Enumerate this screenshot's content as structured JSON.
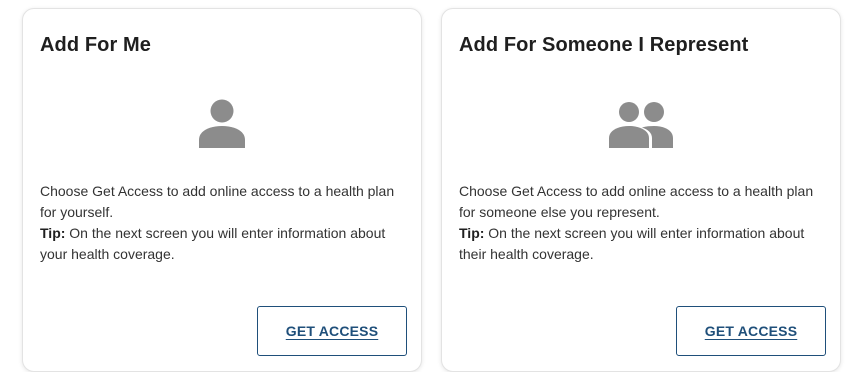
{
  "colors": {
    "icon": "#8c8c8c",
    "button_border": "#1f4f7a",
    "button_text": "#1f4f7a",
    "title": "#1f1f1f",
    "text": "#333333"
  },
  "cards": [
    {
      "title": "Add For Me",
      "icon": "person-icon",
      "desc_line1": "Choose Get Access to add online access to a health plan for yourself.",
      "tip_label": "Tip:",
      "tip_text": " On the next screen you will enter information about your health coverage.",
      "button_label": "GET ACCESS"
    },
    {
      "title": "Add For Someone I Represent",
      "icon": "people-icon",
      "desc_line1": "Choose Get Access to add online access to a health plan for someone else you represent.",
      "tip_label": "Tip:",
      "tip_text": " On the next screen you will enter information about their health coverage.",
      "button_label": "GET ACCESS"
    }
  ]
}
